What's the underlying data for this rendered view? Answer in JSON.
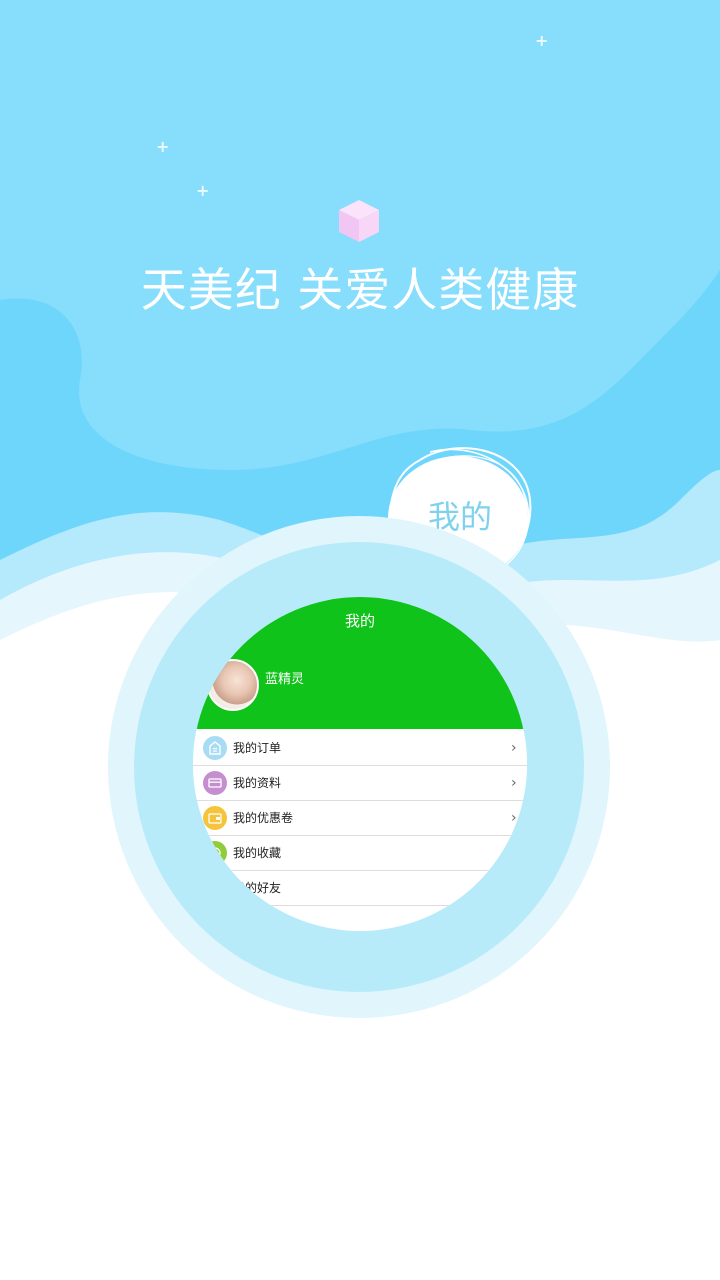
{
  "slogan": "天美纪 关爱人类健康",
  "bubble_label": "我的",
  "screen": {
    "title": "我的",
    "username": "蓝精灵",
    "menu": [
      {
        "label": "我的订单",
        "icon": "order-icon",
        "icon_color": "#a8dcf5",
        "has_arrow": true
      },
      {
        "label": "我的资料",
        "icon": "card-icon",
        "icon_color": "#c58fcf",
        "has_arrow": true
      },
      {
        "label": "我的优惠卷",
        "icon": "wallet-icon",
        "icon_color": "#f6c43a",
        "has_arrow": true
      },
      {
        "label": "我的收藏",
        "icon": "favorite-icon",
        "icon_color": "#8fce3a",
        "has_arrow": false
      },
      {
        "label": "我的好友",
        "icon": "friends-icon",
        "icon_color": "#ffffff",
        "has_arrow": false
      }
    ]
  },
  "colors": {
    "sky": "#86ddfc",
    "header_green": "#0fc31b",
    "ring_outer": "#e0f5fc",
    "ring_inner": "#b8ebfa",
    "bubble_text": "#7fd2ee"
  }
}
